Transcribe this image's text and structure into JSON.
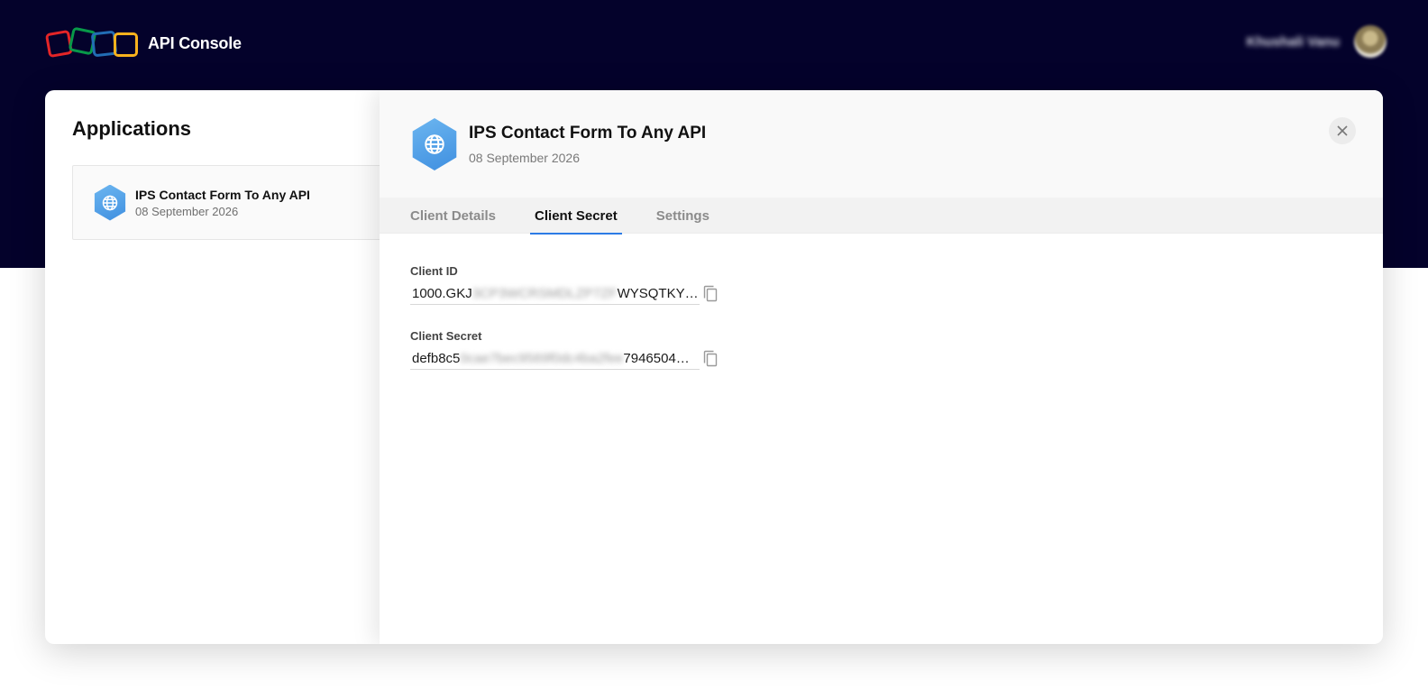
{
  "header": {
    "brand": "API Console",
    "user_name": "Khushali Vanu"
  },
  "applications": {
    "title": "Applications",
    "items": [
      {
        "name": "IPS Contact Form To Any API",
        "date": "08 September 2026"
      }
    ]
  },
  "detail": {
    "title": "IPS Contact Form To Any API",
    "date": "08 September 2026",
    "tabs": [
      {
        "label": "Client Details",
        "active": false
      },
      {
        "label": "Client Secret",
        "active": true
      },
      {
        "label": "Settings",
        "active": false
      }
    ],
    "fields": [
      {
        "label": "Client ID",
        "value_start": "1000.GKJ",
        "value_hidden": "3CP3WCRSMDLZP7ZF",
        "value_end": "WYSQTKY…"
      },
      {
        "label": "Client Secret",
        "value_start": "defb8c5",
        "value_hidden": "0cae7bec9569f0dc4ba2fee",
        "value_end": "7946504…"
      }
    ]
  },
  "colors": {
    "header_bg": "#04022b",
    "accent": "#2c7be5",
    "logo": [
      "#e42527",
      "#089949",
      "#226db4",
      "#f9b21d"
    ]
  },
  "icons": {
    "app_icon": "globe-icon",
    "close": "close-icon",
    "copy": "copy-icon"
  }
}
